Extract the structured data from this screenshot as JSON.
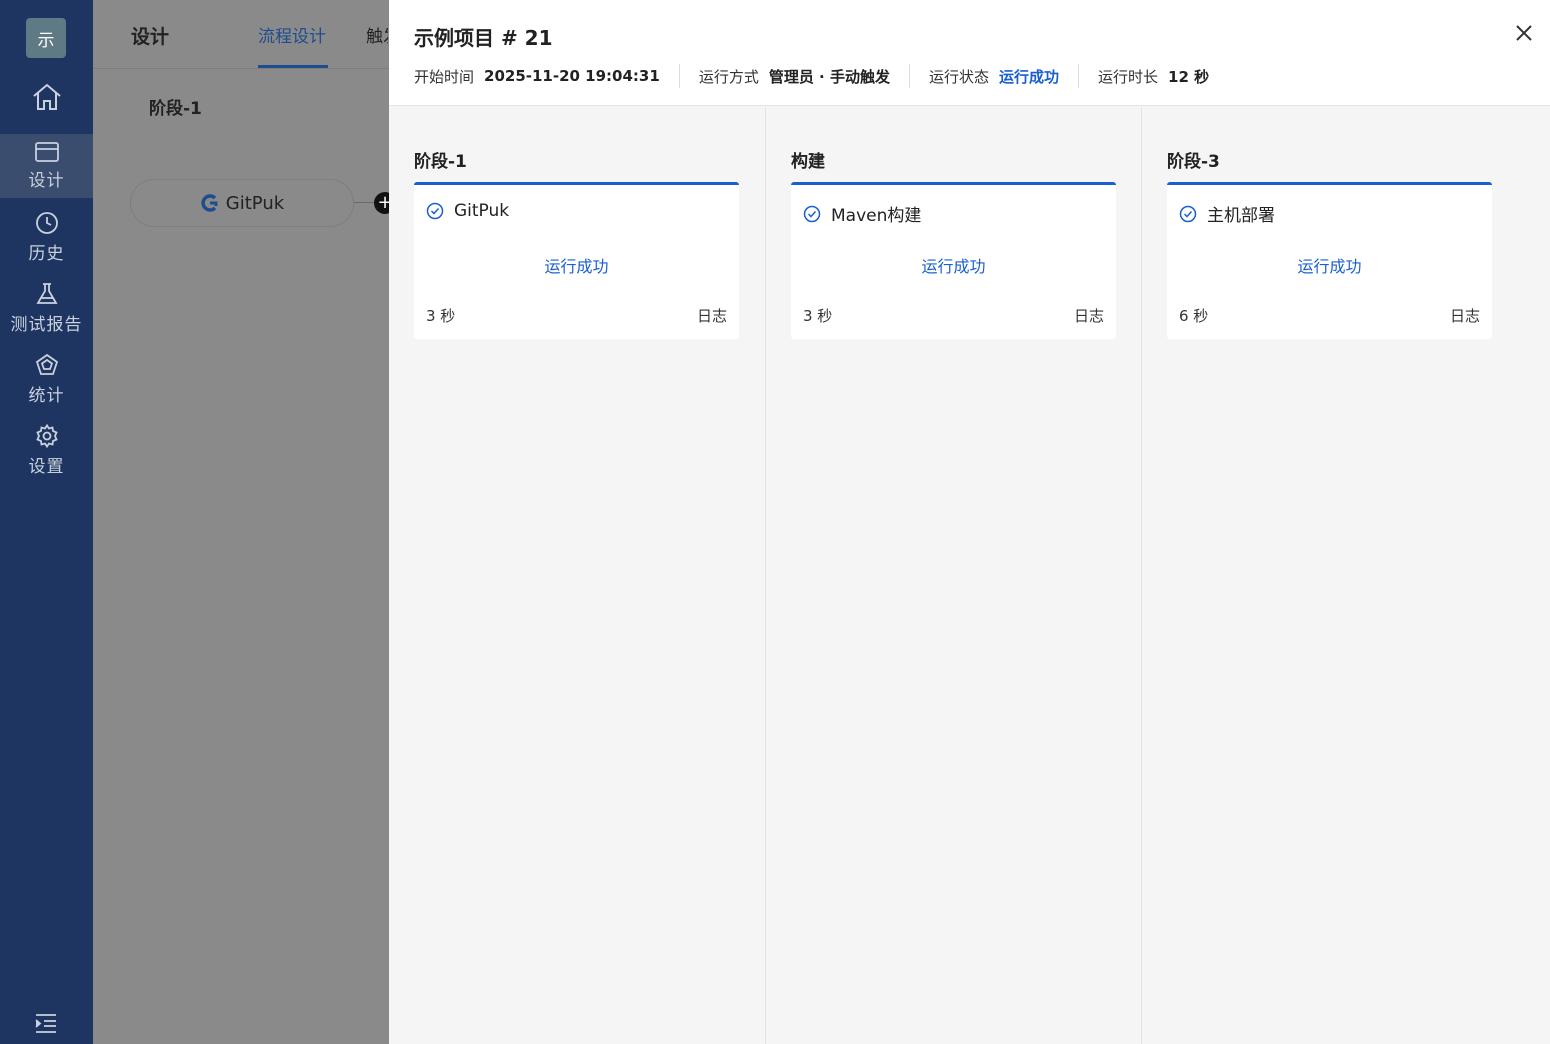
{
  "sidebar": {
    "logo": "示",
    "items": [
      {
        "label": "设计",
        "icon": "layout-icon",
        "active": true
      },
      {
        "label": "历史",
        "icon": "clock-icon"
      },
      {
        "label": "测试报告",
        "icon": "flask-icon"
      },
      {
        "label": "统计",
        "icon": "statistics-icon"
      },
      {
        "label": "设置",
        "icon": "gear-icon"
      }
    ]
  },
  "background": {
    "title": "设计",
    "tabs": [
      "流程设计",
      "触发"
    ],
    "stage": "阶段-1",
    "node": "GitPuk"
  },
  "drawer": {
    "title": "示例项目 # 21",
    "meta": {
      "start_label": "开始时间",
      "start_value": "2025-11-20 19:04:31",
      "mode_label": "运行方式",
      "mode_value": "管理员 · 手动触发",
      "status_label": "运行状态",
      "status_value": "运行成功",
      "duration_label": "运行时长",
      "duration_value": "12 秒"
    },
    "stages": [
      {
        "title": "阶段-1",
        "task": "GitPuk",
        "status": "运行成功",
        "duration": "3 秒",
        "log": "日志"
      },
      {
        "title": "构建",
        "task": "Maven构建",
        "status": "运行成功",
        "duration": "3 秒",
        "log": "日志"
      },
      {
        "title": "阶段-3",
        "task": "主机部署",
        "status": "运行成功",
        "duration": "6 秒",
        "log": "日志"
      }
    ]
  },
  "colors": {
    "sidebar": "#1e3561",
    "accent": "#1a5fd0",
    "overlay": "#8a8a8a"
  }
}
